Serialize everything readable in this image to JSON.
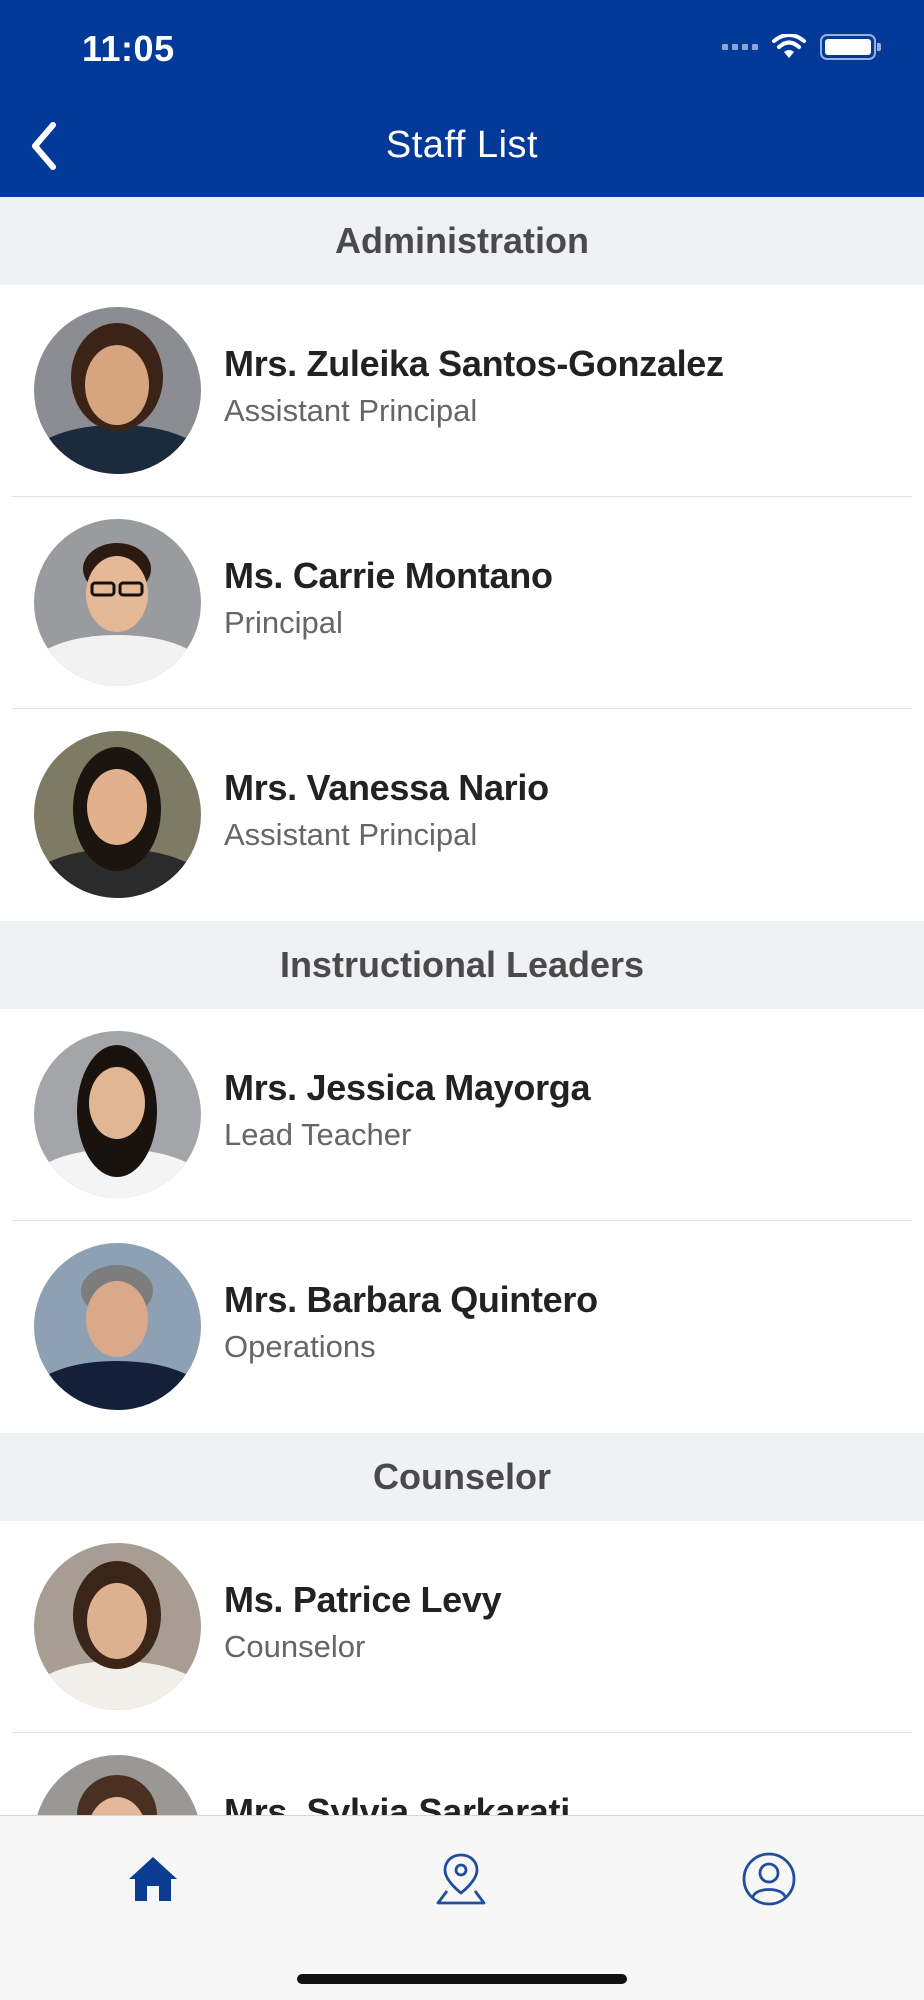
{
  "status_bar": {
    "time": "11:05"
  },
  "nav": {
    "title": "Staff List",
    "back_icon": "chevron-left-icon"
  },
  "sections": [
    {
      "title": "Administration",
      "staff": [
        {
          "name": "Mrs. Zuleika Santos-Gonzalez",
          "role": "Assistant Principal"
        },
        {
          "name": "Ms. Carrie Montano",
          "role": "Principal"
        },
        {
          "name": "Mrs. Vanessa Nario",
          "role": "Assistant Principal"
        }
      ]
    },
    {
      "title": "Instructional Leaders",
      "staff": [
        {
          "name": "Mrs. Jessica Mayorga",
          "role": "Lead Teacher"
        },
        {
          "name": "Mrs. Barbara Quintero",
          "role": "Operations"
        }
      ]
    },
    {
      "title": "Counselor",
      "staff": [
        {
          "name": "Ms. Patrice Levy",
          "role": "Counselor"
        },
        {
          "name": "Mrs. Sylvia Sarkarati",
          "role": ""
        }
      ]
    }
  ],
  "tabbar": {
    "items": [
      {
        "icon": "home-icon",
        "active": true
      },
      {
        "icon": "map-pin-icon",
        "active": false
      },
      {
        "icon": "profile-icon",
        "active": false
      }
    ]
  },
  "colors": {
    "brand": "#033a99",
    "section_bg": "#eff1f4",
    "active_tab": "#0a3d91",
    "inactive_tab": "#1f4f9c"
  }
}
